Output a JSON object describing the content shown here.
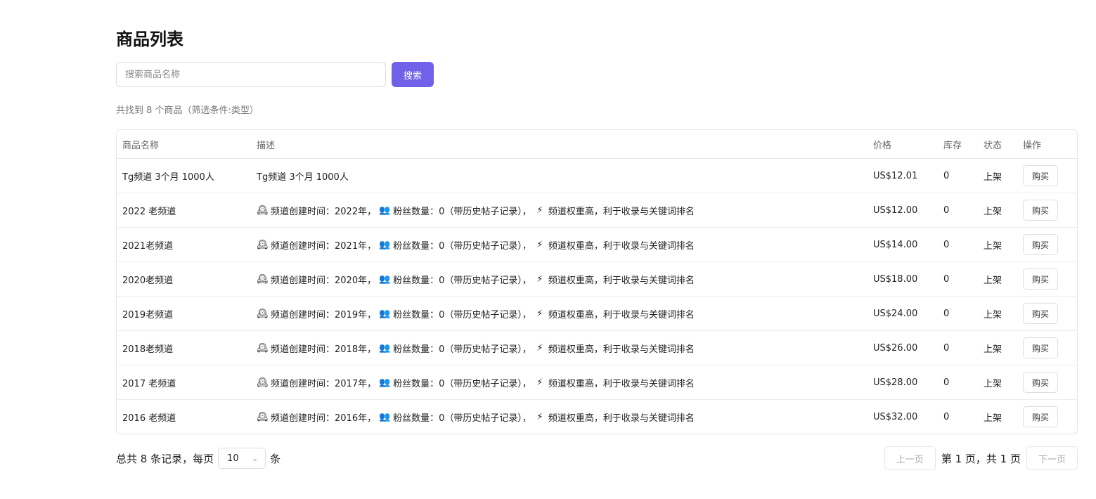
{
  "page": {
    "title": "商品列表"
  },
  "search": {
    "placeholder": "搜索商品名称",
    "value": "",
    "button_label": "搜索"
  },
  "result_summary": "共找到 8 个商品（筛选条件:类型）",
  "table": {
    "headers": [
      "商品名称",
      "描述",
      "价格",
      "库存",
      "状态",
      "操作"
    ],
    "rows": [
      {
        "name": "Tg频道 3个月 1000人",
        "desc_plain": "Tg频道 3个月 1000人",
        "price": "US$12.01",
        "stock": "0",
        "status": "上架",
        "action": "购买"
      },
      {
        "name": "2022 老频道",
        "desc_year": "频道创建时间：2022年，",
        "desc_fans": "粉丝数量：0（带历史帖子记录），",
        "desc_weight": "频道权重高，利于收录与关键词排名",
        "price": "US$12.00",
        "stock": "0",
        "status": "上架",
        "action": "购买"
      },
      {
        "name": "2021老频道",
        "desc_year": "频道创建时间：2021年，",
        "desc_fans": "粉丝数量：0（带历史帖子记录），",
        "desc_weight": "频道权重高，利于收录与关键词排名",
        "price": "US$14.00",
        "stock": "0",
        "status": "上架",
        "action": "购买"
      },
      {
        "name": "2020老频道",
        "desc_year": "频道创建时间：2020年，",
        "desc_fans": "粉丝数量：0（带历史帖子记录），",
        "desc_weight": "频道权重高，利于收录与关键词排名",
        "price": "US$18.00",
        "stock": "0",
        "status": "上架",
        "action": "购买"
      },
      {
        "name": "2019老频道",
        "desc_year": "频道创建时间：2019年，",
        "desc_fans": "粉丝数量：0（带历史帖子记录），",
        "desc_weight": "频道权重高，利于收录与关键词排名",
        "price": "US$24.00",
        "stock": "0",
        "status": "上架",
        "action": "购买"
      },
      {
        "name": "2018老频道",
        "desc_year": "频道创建时间：2018年，",
        "desc_fans": "粉丝数量：0（带历史帖子记录），",
        "desc_weight": "频道权重高，利于收录与关键词排名",
        "price": "US$26.00",
        "stock": "0",
        "status": "上架",
        "action": "购买"
      },
      {
        "name": "2017 老频道",
        "desc_year": "频道创建时间：2017年，",
        "desc_fans": "粉丝数量：0（带历史帖子记录），",
        "desc_weight": "频道权重高，利于收录与关键词排名",
        "price": "US$28.00",
        "stock": "0",
        "status": "上架",
        "action": "购买"
      },
      {
        "name": "2016 老频道",
        "desc_year": "频道创建时间：2016年，",
        "desc_fans": "粉丝数量：0（带历史帖子记录），",
        "desc_weight": "频道权重高，利于收录与关键词排名",
        "price": "US$32.00",
        "stock": "0",
        "status": "上架",
        "action": "购买"
      }
    ],
    "desc_icons": {
      "year": "mantel-clock-icon",
      "fans": "busts-icon",
      "weight": "lightning-icon"
    }
  },
  "pagination": {
    "total_prefix": "总共 8 条记录，每页",
    "page_size": "10",
    "total_suffix": "条",
    "prev_label": "上一页",
    "page_info": "第 1 页，共 1 页",
    "next_label": "下一页"
  },
  "colors": {
    "accent": "#7061e8"
  }
}
